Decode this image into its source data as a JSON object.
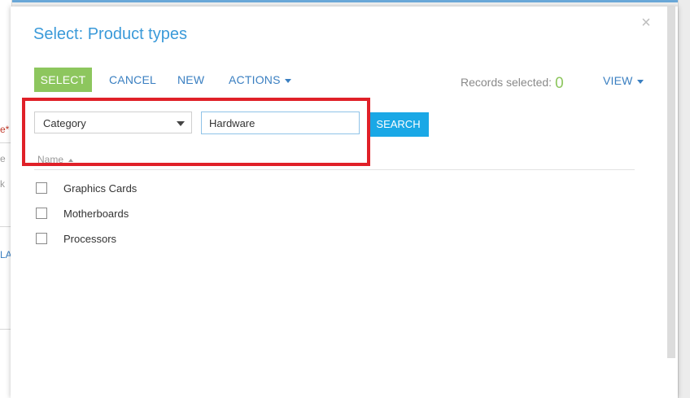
{
  "modal": {
    "title": "Select: Product types",
    "close_glyph": "×"
  },
  "toolbar": {
    "select_label": "SELECT",
    "cancel_label": "CANCEL",
    "new_label": "NEW",
    "actions_label": "ACTIONS",
    "records_label": "Records selected:",
    "records_count": "0",
    "view_label": "VIEW"
  },
  "filter": {
    "column_selected": "Category",
    "search_value": "Hardware",
    "search_label": "SEARCH"
  },
  "list": {
    "column_header": "Name",
    "rows": [
      {
        "label": "Graphics Cards",
        "checked": false
      },
      {
        "label": "Motherboards",
        "checked": false
      },
      {
        "label": "Processors",
        "checked": false
      }
    ]
  },
  "background": {
    "frag_required_marker": "e*",
    "frag_e": "e",
    "frag_k": "k",
    "frag_la": "LA"
  },
  "colors": {
    "accent_blue": "#3a9ad9",
    "select_green": "#8dc65e",
    "search_blue": "#1aa8e6",
    "highlight_red": "#e02028"
  }
}
